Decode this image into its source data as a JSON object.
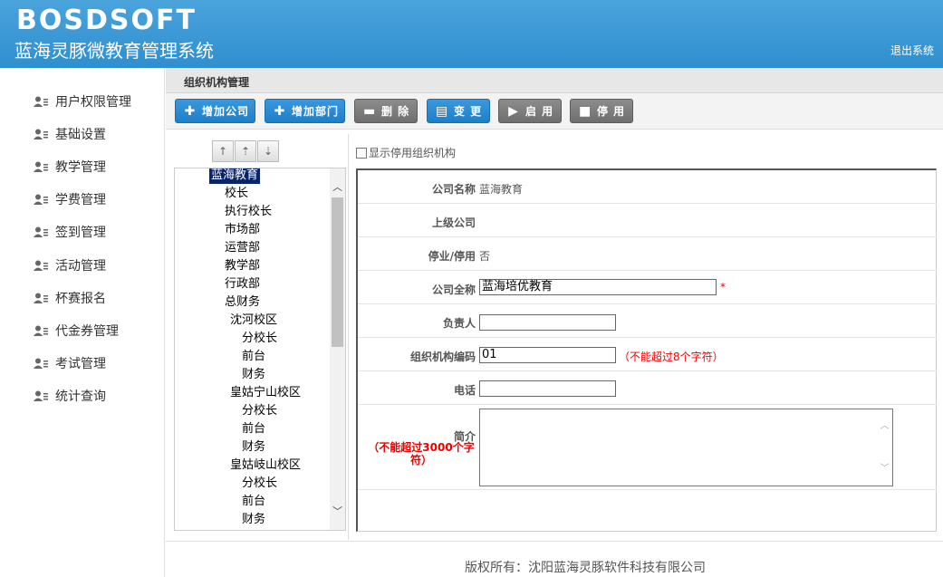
{
  "header": {
    "logo": "BOSDSOFT",
    "title": "蓝海灵豚微教育管理系统",
    "logout": "退出系统"
  },
  "sidebar": {
    "items": [
      {
        "label": "用户权限管理"
      },
      {
        "label": "基础设置"
      },
      {
        "label": "教学管理"
      },
      {
        "label": "学费管理"
      },
      {
        "label": "签到管理"
      },
      {
        "label": "活动管理"
      },
      {
        "label": "杯赛报名"
      },
      {
        "label": "代金券管理"
      },
      {
        "label": "考试管理"
      },
      {
        "label": "统计查询"
      }
    ]
  },
  "breadcrumb": "组织机构管理",
  "toolbar": {
    "add_company": "增加公司",
    "add_dept": "增加部门",
    "delete": "删 除",
    "change": "变 更",
    "enable": "启 用",
    "disable": "停 用"
  },
  "tree": {
    "nodes": [
      {
        "label": "蓝海教育"
      },
      {
        "label": "校长"
      },
      {
        "label": "执行校长"
      },
      {
        "label": "市场部"
      },
      {
        "label": "运营部"
      },
      {
        "label": "教学部"
      },
      {
        "label": "行政部"
      },
      {
        "label": "总财务"
      },
      {
        "label": "沈河校区"
      },
      {
        "label": "分校长"
      },
      {
        "label": "前台"
      },
      {
        "label": "财务"
      },
      {
        "label": "皇姑宁山校区"
      },
      {
        "label": "分校长"
      },
      {
        "label": "前台"
      },
      {
        "label": "财务"
      },
      {
        "label": "皇姑岐山校区"
      },
      {
        "label": "分校长"
      },
      {
        "label": "前台"
      },
      {
        "label": "财务"
      }
    ]
  },
  "form": {
    "show_disabled_label": "显示停用组织机构",
    "company_name_label": "公司名称",
    "company_name_value": "蓝海教育",
    "parent_label": "上级公司",
    "status_label": "停业/停用",
    "status_value": "否",
    "full_name_label": "公司全称",
    "full_name_value": "蓝海培优教育",
    "required_mark": "*",
    "manager_label": "负责人",
    "code_label": "组织机构编码",
    "code_value": "01",
    "code_hint": "（不能超过8个字符）",
    "phone_label": "电话",
    "intro_label": "简介",
    "intro_hint": "（不能超过3000个字符）"
  },
  "footer": "版权所有：沈阳蓝海灵豚软件科技有限公司"
}
